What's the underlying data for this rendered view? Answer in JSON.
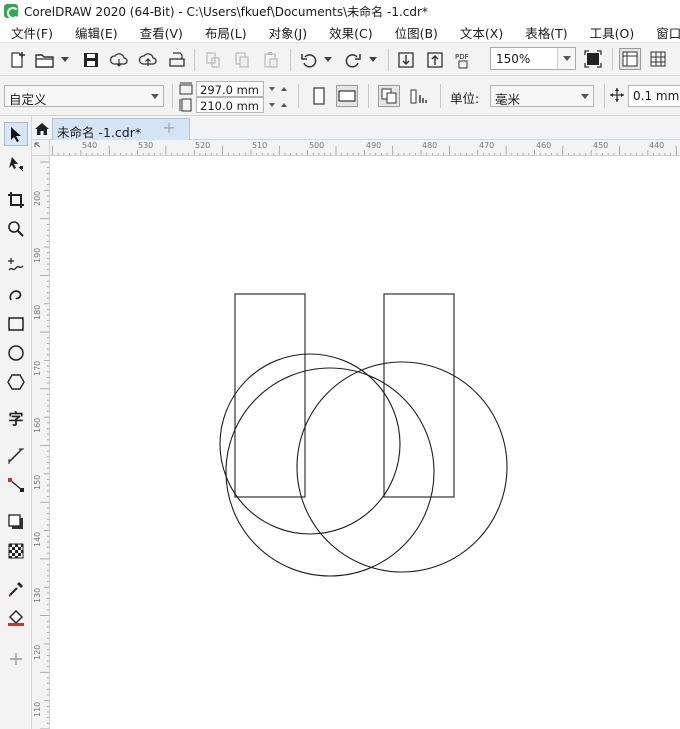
{
  "window": {
    "title": "CorelDRAW 2020 (64-Bit) - C:\\Users\\fkuef\\Documents\\未命名 -1.cdr*"
  },
  "menu": {
    "items": [
      "文件(F)",
      "编辑(E)",
      "查看(V)",
      "布局(L)",
      "对象(J)",
      "效果(C)",
      "位图(B)",
      "文本(X)",
      "表格(T)",
      "工具(O)",
      "窗口"
    ]
  },
  "toolbar": {
    "zoom": "150%",
    "pdf_label": "PDF"
  },
  "property_bar": {
    "page_preset": "自定义",
    "width": "297.0 mm",
    "height": "210.0 mm",
    "unit_label": "单位:",
    "unit_value": "毫米",
    "nudge": "0.1 mm"
  },
  "toolbox": {
    "text_tool_glyph": "字"
  },
  "tabs": {
    "document": "未命名 -1.cdr*",
    "add": "+"
  },
  "rulers": {
    "horizontal": [
      "540",
      "530",
      "520",
      "510",
      "500",
      "490",
      "480",
      "470",
      "460",
      "450",
      "440"
    ],
    "vertical": [
      "200",
      "190",
      "180",
      "170",
      "160",
      "150",
      "140",
      "130",
      "120",
      "110"
    ]
  },
  "colors": {
    "accent": "#d5e4f4",
    "stroke": "#1e1e1e"
  }
}
